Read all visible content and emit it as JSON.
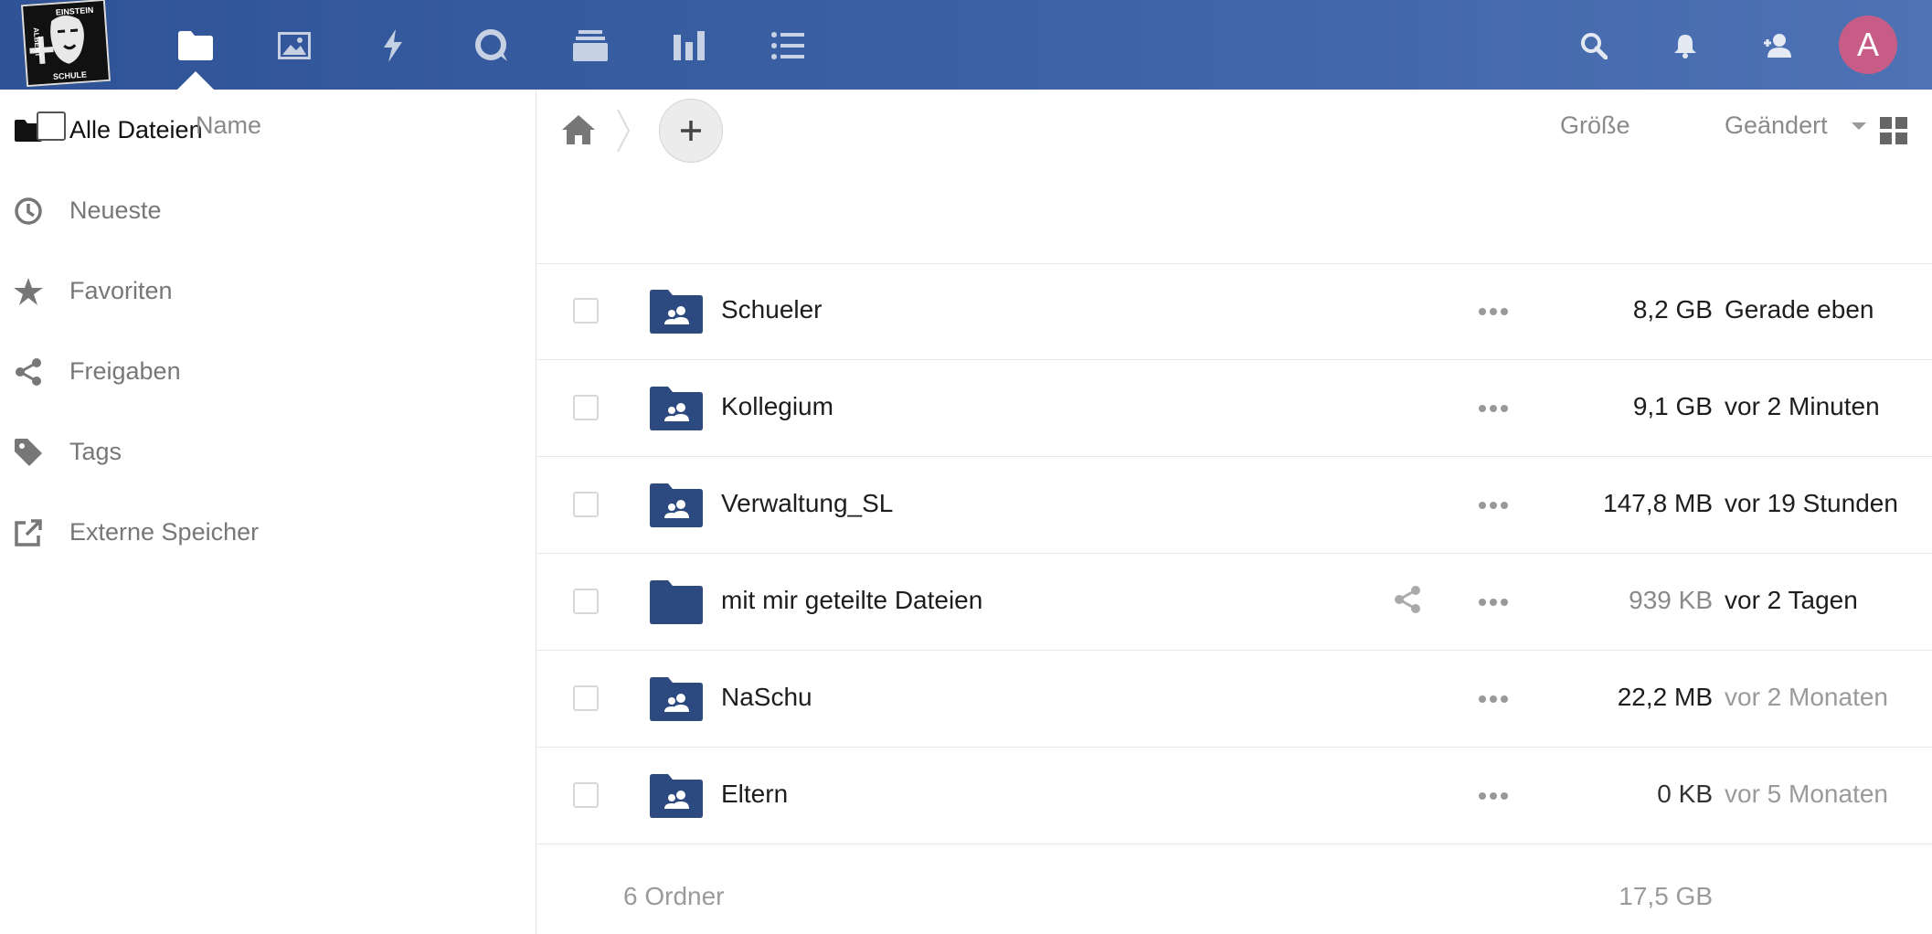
{
  "logo": {
    "text_top": "EINSTEIN",
    "text_left": "ALBERT",
    "text_bottom": "SCHULE"
  },
  "header": {
    "apps": [
      {
        "icon": "folder-icon",
        "active": true
      },
      {
        "icon": "image-icon",
        "active": false
      },
      {
        "icon": "activity-bolt-icon",
        "active": false
      },
      {
        "icon": "talk-icon",
        "active": false
      },
      {
        "icon": "stack-icon",
        "active": false
      },
      {
        "icon": "chart-bars-icon",
        "active": false
      },
      {
        "icon": "tasks-list-icon",
        "active": false
      }
    ],
    "right_icons": [
      "search-icon",
      "bell-icon",
      "contacts-icon"
    ],
    "avatar_letter": "A",
    "avatar_color": "#c75d86",
    "gradient": [
      "#2f5396",
      "#4e72b4"
    ]
  },
  "sidebar": {
    "items": [
      {
        "label": "Alle Dateien",
        "icon": "folder-icon",
        "active": true
      },
      {
        "label": "Neueste",
        "icon": "clock-icon",
        "active": false
      },
      {
        "label": "Favoriten",
        "icon": "star-icon",
        "active": false
      },
      {
        "label": "Freigaben",
        "icon": "share-icon",
        "active": false
      },
      {
        "label": "Tags",
        "icon": "tag-icon",
        "active": false
      },
      {
        "label": "Externe Speicher",
        "icon": "external-link-icon",
        "active": false
      }
    ]
  },
  "files": {
    "columns": {
      "name": "Name",
      "size": "Größe",
      "modified": "Geändert"
    },
    "rows": [
      {
        "name": "Schueler",
        "size": "8,2 GB",
        "modified": "Gerade eben",
        "shared_group": true,
        "share_icon": false,
        "size_color": "#1d1d1d",
        "modified_color": "#1d1d1d"
      },
      {
        "name": "Kollegium",
        "size": "9,1 GB",
        "modified": "vor 2 Minuten",
        "shared_group": true,
        "share_icon": false,
        "size_color": "#1d1d1d",
        "modified_color": "#1d1d1d"
      },
      {
        "name": "Verwaltung_SL",
        "size": "147,8 MB",
        "modified": "vor 19 Stunden",
        "shared_group": true,
        "share_icon": false,
        "size_color": "#1d1d1d",
        "modified_color": "#1d1d1d"
      },
      {
        "name": "mit mir geteilte Dateien",
        "size": "939 KB",
        "modified": "vor 2 Tagen",
        "shared_group": false,
        "share_icon": true,
        "size_color": "#8a8a8a",
        "modified_color": "#1d1d1d"
      },
      {
        "name": "NaSchu",
        "size": "22,2 MB",
        "modified": "vor 2 Monaten",
        "shared_group": true,
        "share_icon": false,
        "size_color": "#1d1d1d",
        "modified_color": "#9a9a9a"
      },
      {
        "name": "Eltern",
        "size": "0 KB",
        "modified": "vor 5 Monaten",
        "shared_group": true,
        "share_icon": false,
        "size_color": "#333333",
        "modified_color": "#9a9a9a"
      }
    ],
    "summary": {
      "count": "6 Ordner",
      "total": "17,5 GB"
    }
  },
  "colors": {
    "folder": "#2c4a80",
    "accent": "#2f5396"
  }
}
